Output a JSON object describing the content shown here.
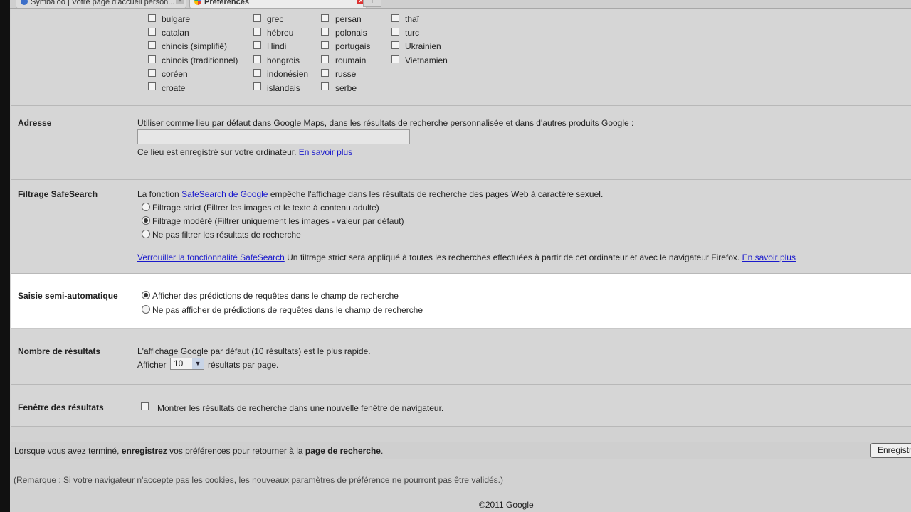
{
  "tabs": [
    {
      "label": "Symbaloo | Votre page d'accueil person...",
      "close": "×"
    },
    {
      "label": "Préférences",
      "close": "×"
    }
  ],
  "newtab": "+",
  "languages": {
    "col1": [
      "bulgare",
      "catalan",
      "chinois (simplifié)",
      "chinois (traditionnel)",
      "coréen",
      "croate"
    ],
    "col2": [
      "grec",
      "hébreu",
      "Hindi",
      "hongrois",
      "indonésien",
      "islandais"
    ],
    "col3": [
      "persan",
      "polonais",
      "portugais",
      "roumain",
      "russe",
      "serbe"
    ],
    "col4": [
      "thaï",
      "turc",
      "Ukrainien",
      "Vietnamien"
    ]
  },
  "adresse": {
    "title": "Adresse",
    "description": "Utiliser comme lieu par défaut dans Google Maps, dans les résultats de recherche personnalisée et dans d'autres produits Google :",
    "value": "",
    "saved_note": "Ce lieu est enregistré sur votre ordinateur.",
    "learn_more": "En savoir plus"
  },
  "safesearch": {
    "title": "Filtrage SafeSearch",
    "intro_before": "La fonction",
    "intro_link": "SafeSearch de Google",
    "intro_after": "empêche l'affichage dans les résultats de recherche des pages Web à caractère sexuel.",
    "options": [
      {
        "label": "Filtrage strict (Filtrer les images et le texte à contenu adulte)",
        "selected": false
      },
      {
        "label": "Filtrage modéré (Filtrer uniquement les images - valeur par défaut)",
        "selected": true
      },
      {
        "label": "Ne pas filtrer les résultats de recherche",
        "selected": false
      }
    ],
    "lock_link": "Verrouiller la fonctionnalité SafeSearch",
    "lock_text": "Un filtrage strict sera appliqué à toutes les recherches effectuées à partir de cet ordinateur et avec le navigateur Firefox.",
    "learn_more": "En savoir plus"
  },
  "autocomplete": {
    "title": "Saisie semi-automatique",
    "options": [
      {
        "label": "Afficher des prédictions de requêtes dans le champ de recherche",
        "selected": true
      },
      {
        "label": "Ne pas afficher de prédictions de requêtes dans le champ de recherche",
        "selected": false
      }
    ]
  },
  "results_count": {
    "title": "Nombre de résultats",
    "description": "L'affichage Google par défaut (10 résultats) est le plus rapide.",
    "prefix": "Afficher",
    "value": "10",
    "suffix": "résultats par page."
  },
  "results_window": {
    "title": "Fenêtre des résultats",
    "label": "Montrer les résultats de recherche dans une nouvelle fenêtre de navigateur.",
    "checked": false
  },
  "footer": {
    "text_a": "Lorsque vous avez terminé,",
    "text_b": "enregistrez",
    "text_c": "vos préférences pour retourner à la",
    "text_d": "page de recherche",
    "text_e": ".",
    "save_button": "Enregistrer",
    "remark": "(Remarque : Si votre navigateur n'accepte pas les cookies, les nouveaux paramètres de préférence ne pourront pas être validés.)",
    "copyright": "©2011 Google"
  }
}
